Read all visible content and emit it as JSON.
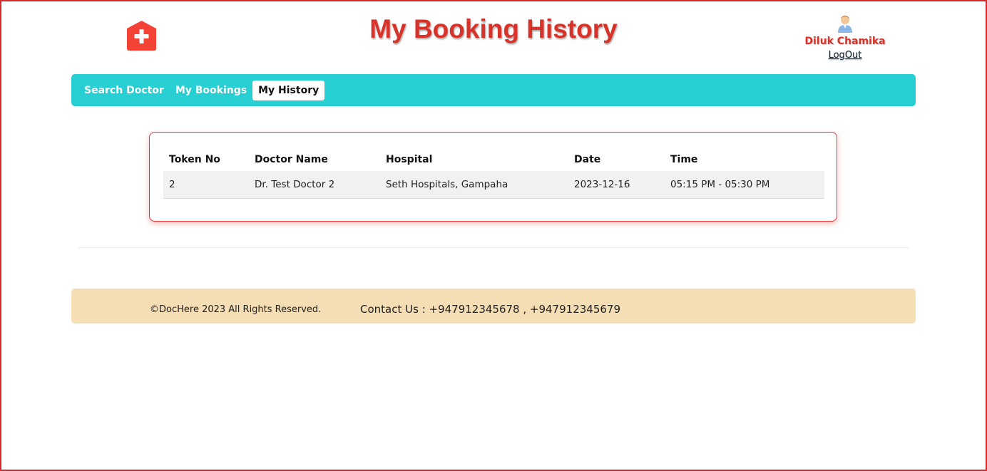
{
  "header": {
    "title": "My Booking History",
    "logo_icon": "medical-cross-icon",
    "logo_color": "#f44336",
    "user": {
      "avatar_icon": "user-avatar-icon",
      "name": "Diluk Chamika",
      "logout_label": "LogOut"
    }
  },
  "nav": {
    "items": [
      {
        "label": "Search Doctor",
        "active": false
      },
      {
        "label": "My Bookings",
        "active": false
      },
      {
        "label": "My History",
        "active": true
      }
    ],
    "background": "#27cfd3"
  },
  "history_table": {
    "columns": [
      "Token No",
      "Doctor Name",
      "Hospital",
      "Date",
      "Time"
    ],
    "rows": [
      [
        "2",
        "Dr. Test Doctor 2",
        "Seth Hospitals, Gampaha",
        "2023-12-16",
        "05:15 PM - 05:30 PM"
      ]
    ]
  },
  "footer": {
    "copyright": "©DocHere 2023 All Rights Reserved.",
    "contact": "Contact Us : +947912345678 , +947912345679",
    "background": "#f5ddb4"
  },
  "colors": {
    "accent_red": "#d8332a",
    "frame_border": "#d42a2a"
  }
}
